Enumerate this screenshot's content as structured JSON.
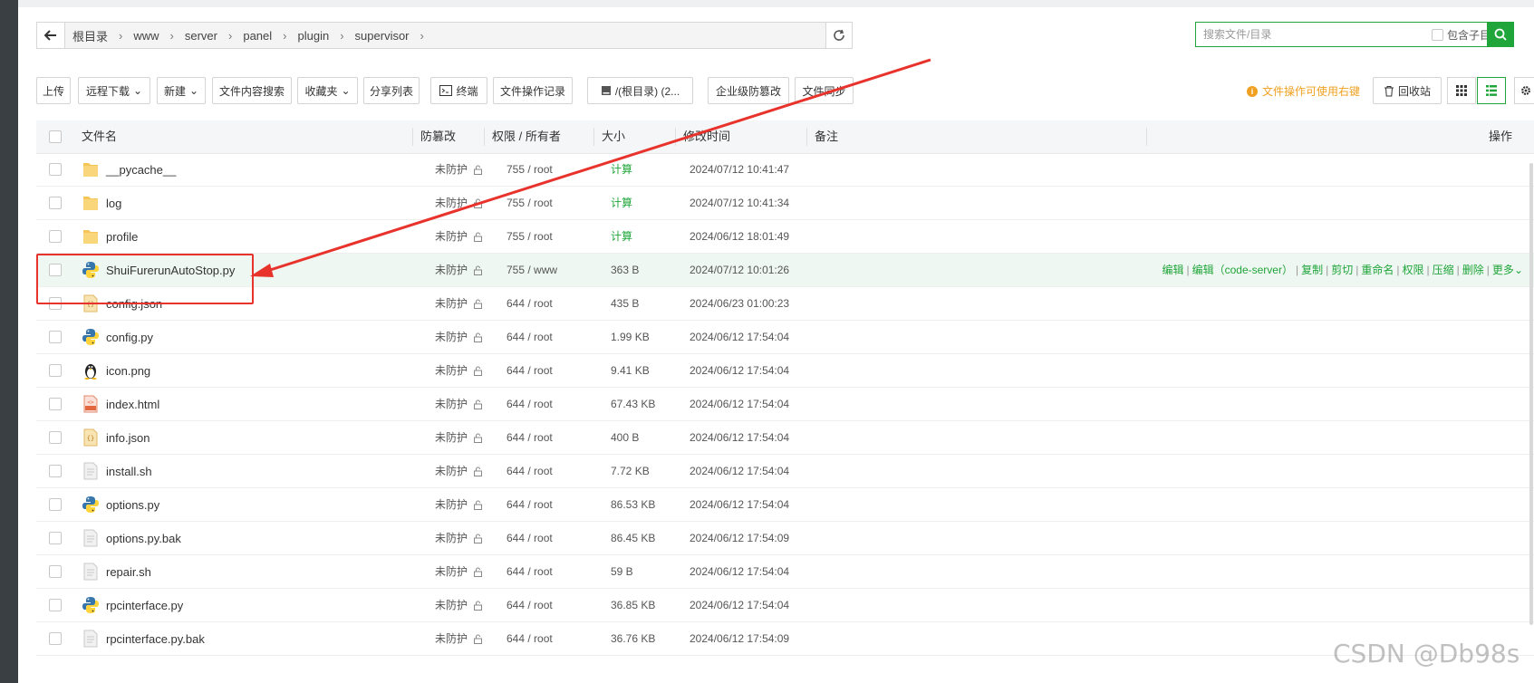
{
  "path": {
    "crumbs": [
      "根目录",
      "www",
      "server",
      "panel",
      "plugin",
      "supervisor"
    ]
  },
  "search": {
    "placeholder": "搜索文件/目录",
    "include_sub_label": "包含子目录"
  },
  "toolbar": {
    "upload": "上传",
    "remote_download": "远程下载",
    "new": "新建",
    "content_search": "文件内容搜索",
    "favorites": "收藏夹",
    "share_list": "分享列表",
    "terminal": "终端",
    "op_log": "文件操作记录",
    "disk": "/(根目录) (2...",
    "tamper_proof": "企业级防篡改",
    "file_sync": "文件同步",
    "right_click_tip": "文件操作可使用右键",
    "recycle_bin": "回收站"
  },
  "columns": {
    "name": "文件名",
    "tamper": "防篡改",
    "perm": "权限 / 所有者",
    "size": "大小",
    "mtime": "修改时间",
    "note": "备注",
    "ops": "操作"
  },
  "files": [
    {
      "name": "__pycache__",
      "icon": "folder-icon",
      "tamper": "未防护",
      "perm": "755 / root",
      "size": "计算",
      "mtime": "2024/07/12 10:41:47"
    },
    {
      "name": "log",
      "icon": "folder-icon",
      "tamper": "未防护",
      "perm": "755 / root",
      "size": "计算",
      "mtime": "2024/07/12 10:41:34"
    },
    {
      "name": "profile",
      "icon": "folder-icon",
      "tamper": "未防护",
      "perm": "755 / root",
      "size": "计算",
      "mtime": "2024/06/12 18:01:49"
    },
    {
      "name": "ShuiFurerunAutoStop.py",
      "icon": "python-icon",
      "tamper": "未防护",
      "perm": "755 / www",
      "size": "363 B",
      "mtime": "2024/07/12 10:01:26"
    },
    {
      "name": "config.json",
      "icon": "json-file-icon",
      "tamper": "未防护",
      "perm": "644 / root",
      "size": "435 B",
      "mtime": "2024/06/23 01:00:23"
    },
    {
      "name": "config.py",
      "icon": "python-icon",
      "tamper": "未防护",
      "perm": "644 / root",
      "size": "1.99 KB",
      "mtime": "2024/06/12 17:54:04"
    },
    {
      "name": "icon.png",
      "icon": "linux-penguin-icon",
      "tamper": "未防护",
      "perm": "644 / root",
      "size": "9.41 KB",
      "mtime": "2024/06/12 17:54:04"
    },
    {
      "name": "index.html",
      "icon": "html-file-icon",
      "tamper": "未防护",
      "perm": "644 / root",
      "size": "67.43 KB",
      "mtime": "2024/06/12 17:54:04"
    },
    {
      "name": "info.json",
      "icon": "json-file-icon",
      "tamper": "未防护",
      "perm": "644 / root",
      "size": "400 B",
      "mtime": "2024/06/12 17:54:04"
    },
    {
      "name": "install.sh",
      "icon": "text-file-icon",
      "tamper": "未防护",
      "perm": "644 / root",
      "size": "7.72 KB",
      "mtime": "2024/06/12 17:54:04"
    },
    {
      "name": "options.py",
      "icon": "python-icon",
      "tamper": "未防护",
      "perm": "644 / root",
      "size": "86.53 KB",
      "mtime": "2024/06/12 17:54:04"
    },
    {
      "name": "options.py.bak",
      "icon": "text-file-icon",
      "tamper": "未防护",
      "perm": "644 / root",
      "size": "86.45 KB",
      "mtime": "2024/06/12 17:54:09"
    },
    {
      "name": "repair.sh",
      "icon": "text-file-icon",
      "tamper": "未防护",
      "perm": "644 / root",
      "size": "59 B",
      "mtime": "2024/06/12 17:54:04"
    },
    {
      "name": "rpcinterface.py",
      "icon": "python-icon",
      "tamper": "未防护",
      "perm": "644 / root",
      "size": "36.85 KB",
      "mtime": "2024/06/12 17:54:04"
    },
    {
      "name": "rpcinterface.py.bak",
      "icon": "text-file-icon",
      "tamper": "未防护",
      "perm": "644 / root",
      "size": "36.76 KB",
      "mtime": "2024/06/12 17:54:09"
    }
  ],
  "row_ops": [
    "编辑",
    "编辑（code-server）",
    "复制",
    "剪切",
    "重命名",
    "权限",
    "压缩",
    "删除",
    "更多"
  ],
  "watermark": "CSDN @Db98s",
  "colors": {
    "accent": "#20a53a",
    "annotation": "#e8322c",
    "tip": "#f0a020"
  }
}
